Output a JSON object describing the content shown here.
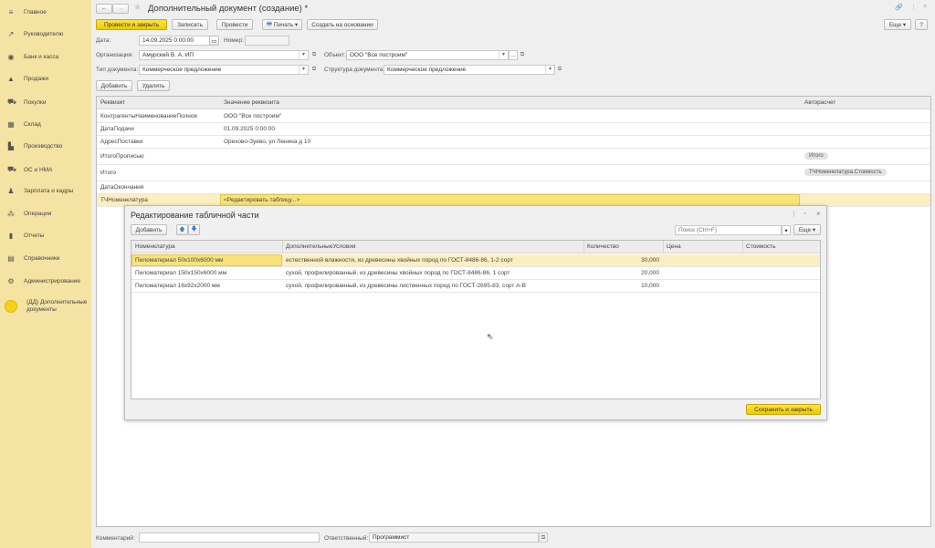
{
  "sidebar": {
    "items": [
      {
        "label": "Главное",
        "icon": "menu-icon"
      },
      {
        "label": "Руководителю",
        "icon": "trend-icon"
      },
      {
        "label": "Банк и касса",
        "icon": "coin-icon"
      },
      {
        "label": "Продажи",
        "icon": "bag-icon"
      },
      {
        "label": "Покупки",
        "icon": "cart-icon"
      },
      {
        "label": "Склад",
        "icon": "warehouse-icon"
      },
      {
        "label": "Производство",
        "icon": "factory-icon"
      },
      {
        "label": "ОС и НМА",
        "icon": "truck-icon"
      },
      {
        "label": "Зарплата и кадры",
        "icon": "person-icon"
      },
      {
        "label": "Операции",
        "icon": "operations-icon"
      },
      {
        "label": "Отчеты",
        "icon": "chart-icon"
      },
      {
        "label": "Справочники",
        "icon": "book-icon"
      },
      {
        "label": "Администрирование",
        "icon": "gear-icon"
      },
      {
        "label": "(ДД) Дополнительные документы",
        "icon": "circle-icon"
      }
    ]
  },
  "header": {
    "title": "Дополнительный документ (создание) *",
    "more": "Еще",
    "help": "?"
  },
  "toolbar": {
    "post_close": "Провести и закрыть",
    "save": "Записать",
    "post": "Провести",
    "print": "Печать",
    "create_based": "Создать на основании"
  },
  "form": {
    "date_label": "Дата:",
    "date_value": "14.09.2025  0:00:00",
    "number_label": "Номер:",
    "number_value": "",
    "org_label": "Организация:",
    "org_value": "Амурский В. А. ИП",
    "object_label": "Объект:",
    "object_value": "ООО \"Все построим\"",
    "doctype_label": "Тип документа:",
    "doctype_value": "Коммерческое предложение",
    "structure_label": "Структура документа:",
    "structure_value": "Коммерческое предложение",
    "add": "Добавить",
    "delete": "Удалить"
  },
  "attributes": {
    "columns": [
      "Реквизит",
      "Значение реквизита",
      "Авторасчет"
    ],
    "rows": [
      {
        "name": "КонтрагентыНаименованиеПолное",
        "value": "ООО \"Все построим\"",
        "auto": ""
      },
      {
        "name": "ДатаПодачи",
        "value": "01.09.2025 0:00:00",
        "auto": ""
      },
      {
        "name": "АдресПоставки",
        "value": "Орехово-Зуево, ул Ленина д 10",
        "auto": ""
      },
      {
        "name": "ИтогоПрописью",
        "value": "",
        "auto": "Итого"
      },
      {
        "name": "Итого",
        "value": "",
        "auto": "ТЧНоменклатура.Стоимость"
      },
      {
        "name": "ДатаОкончания",
        "value": "",
        "auto": ""
      },
      {
        "name": "ТЧНоменклатура",
        "value": "<Редактировать таблицу...>",
        "auto": ""
      }
    ]
  },
  "dialog": {
    "title": "Редактирование табличной части",
    "add": "Добавить",
    "search_placeholder": "Поиск (Ctrl+F)",
    "more": "Еще",
    "columns": [
      "Номенклатура",
      "ДополнительныеУсловия",
      "Количество",
      "Цена",
      "Стоимость"
    ],
    "rows": [
      {
        "item": "Пиломатериал 50х100х6000 мм",
        "cond": "естественной влажности, из древесины хвойных пород по ГОСТ-8486-86, 1-2 сорт",
        "qty": "30,000",
        "price": "",
        "cost": ""
      },
      {
        "item": "Пиломатериал 150х150х6000 мм",
        "cond": "сухой, профилированный, из древесины хвойных пород по ГОСТ-8486-86, 1 сорт",
        "qty": "20,000",
        "price": "",
        "cost": ""
      },
      {
        "item": "Пиломатериал 16х92х2000 мм",
        "cond": "сухой, профилированный, из древесины лиственных пород по ГОСТ-2695-83, сорт А-В",
        "qty": "10,000",
        "price": "",
        "cost": ""
      }
    ],
    "save_close": "Сохранить и закрыть"
  },
  "footer": {
    "comment_label": "Комментарий:",
    "comment_value": "",
    "resp_label": "Ответственный:",
    "resp_value": "Программист"
  },
  "colors": {
    "accent": "#f0c900",
    "sidebar": "#f4e3a3",
    "selected_row": "#fbeec0"
  }
}
